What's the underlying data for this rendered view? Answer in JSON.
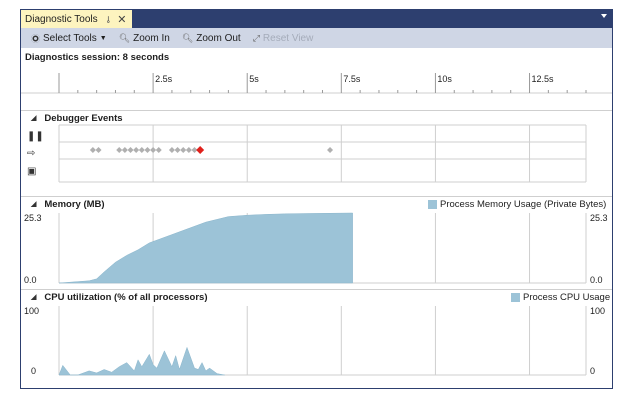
{
  "tab": {
    "title": "Diagnostic Tools",
    "pin_icon": "pin-icon",
    "close_icon": "close-icon"
  },
  "toolbar": {
    "select_tools": "Select Tools",
    "zoom_in": "Zoom In",
    "zoom_out": "Zoom Out",
    "reset_view": "Reset View"
  },
  "session": {
    "label": "Diagnostics session: 8 seconds"
  },
  "ruler": {
    "ticks": [
      "2.5s",
      "5s",
      "7.5s",
      "10s",
      "12.5s"
    ]
  },
  "sections": {
    "debugger": {
      "title": "Debugger Events"
    },
    "memory": {
      "title": "Memory (MB)",
      "legend": "Process Memory Usage (Private Bytes)",
      "max_label": "25.3",
      "min_label": "0.0"
    },
    "cpu": {
      "title": "CPU utilization (% of all processors)",
      "legend": "Process CPU Usage",
      "max_label": "100",
      "min_label": "0"
    }
  },
  "colors": {
    "accent": "#2d3f6f",
    "tab": "#fdf4bf",
    "fill": "#9cc3d7",
    "break": "#e0201b",
    "event": "#b0b0b0"
  },
  "chart_data": [
    {
      "type": "area",
      "title": "Memory (MB)",
      "series": [
        {
          "name": "Process Memory Usage (Private Bytes)",
          "x": [
            0,
            0.8,
            1.0,
            1.2,
            1.5,
            1.8,
            2.1,
            2.4,
            2.7,
            3.0,
            3.3,
            3.6,
            3.9,
            4.2,
            4.5,
            5.0,
            5.5,
            6.0,
            6.5,
            7.8
          ],
          "values": [
            0,
            0.8,
            1.5,
            4.0,
            7.5,
            10.0,
            12.0,
            14.5,
            16.0,
            17.5,
            19.0,
            20.5,
            22.0,
            23.0,
            24.0,
            24.5,
            24.8,
            25.0,
            25.1,
            25.3
          ]
        }
      ],
      "xlim": [
        0,
        14
      ],
      "ylim": [
        0,
        25.3
      ]
    },
    {
      "type": "area",
      "title": "CPU utilization (% of all processors)",
      "series": [
        {
          "name": "Process CPU Usage",
          "x": [
            0,
            0.1,
            0.3,
            0.5,
            0.8,
            1.0,
            1.2,
            1.4,
            1.6,
            1.8,
            2.0,
            2.1,
            2.2,
            2.4,
            2.5,
            2.6,
            2.8,
            3.0,
            3.1,
            3.2,
            3.4,
            3.6,
            3.7,
            3.8,
            3.9,
            4.0,
            4.2,
            4.4
          ],
          "values": [
            0,
            14,
            0,
            0,
            6,
            3,
            8,
            4,
            12,
            18,
            6,
            22,
            12,
            30,
            15,
            10,
            35,
            12,
            28,
            8,
            40,
            10,
            8,
            18,
            6,
            10,
            2,
            0
          ]
        }
      ],
      "xlim": [
        0,
        14
      ],
      "ylim": [
        0,
        100
      ]
    }
  ],
  "events": {
    "diamonds": [
      0.9,
      1.05,
      1.6,
      1.75,
      1.9,
      2.05,
      2.2,
      2.35,
      2.5,
      2.65,
      3.0,
      3.15,
      3.3,
      3.45,
      3.6,
      7.2
    ],
    "breakpoint": 3.75
  }
}
